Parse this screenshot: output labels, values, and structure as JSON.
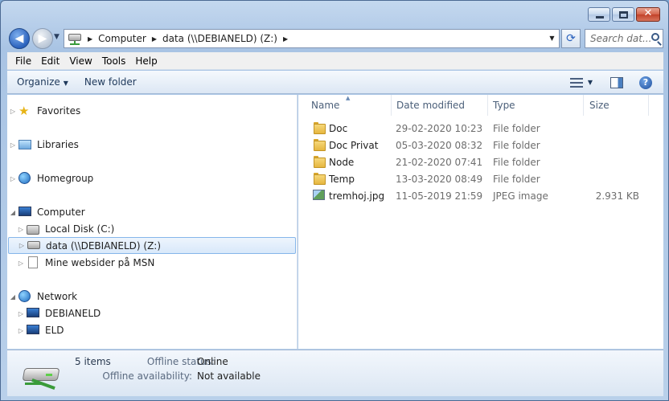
{
  "window": {
    "caption": {
      "close_glyph": "✕"
    }
  },
  "nav": {
    "back_glyph": "◀",
    "forward_glyph": "▶",
    "address": {
      "segments": [
        "Computer",
        "data (\\\\DEBIANELD) (Z:)"
      ],
      "separator_glyph": "▶",
      "dropdown_glyph": "▼"
    },
    "refresh_glyph": "⟳",
    "search_placeholder": "Search dat..."
  },
  "menu": [
    "File",
    "Edit",
    "View",
    "Tools",
    "Help"
  ],
  "commands": {
    "organize": "Organize",
    "organize_dd": "▼",
    "new_folder": "New folder",
    "views_dd": "▼",
    "help_glyph": "?"
  },
  "navpane": {
    "items": [
      {
        "label": "Favorites",
        "icon": "star-icon",
        "level": 0,
        "collapsed": true
      },
      {
        "label": "Libraries",
        "icon": "libraries-icon",
        "level": 0,
        "collapsed": true
      },
      {
        "label": "Homegroup",
        "icon": "homegroup-icon",
        "level": 0,
        "collapsed": true
      },
      {
        "label": "Computer",
        "icon": "computer-icon",
        "level": 0,
        "expanded": true
      },
      {
        "label": "Local Disk (C:)",
        "icon": "local-disk-icon",
        "level": 1,
        "collapsed": true
      },
      {
        "label": "data (\\\\DEBIANELD) (Z:)",
        "icon": "network-drive-icon",
        "level": 1,
        "collapsed": true,
        "selected": true
      },
      {
        "label": "Mine websider på MSN",
        "icon": "page-icon",
        "level": 1,
        "collapsed": true
      },
      {
        "label": "Network",
        "icon": "network-icon",
        "level": 0,
        "expanded": true
      },
      {
        "label": "DEBIANELD",
        "icon": "network-computer-icon",
        "level": 1,
        "collapsed": true
      },
      {
        "label": "ELD",
        "icon": "network-computer-icon",
        "level": 1,
        "collapsed": true
      }
    ],
    "collapsed_glyph": "▷",
    "expanded_glyph": "◢"
  },
  "filelist": {
    "columns": [
      "Name",
      "Date modified",
      "Type",
      "Size"
    ],
    "sort_glyph": "▲",
    "rows": [
      {
        "name": "Doc",
        "date": "29-02-2020 10:23",
        "type": "File folder",
        "size": "",
        "icon": "folder-icon"
      },
      {
        "name": "Doc Privat",
        "date": "05-03-2020 08:32",
        "type": "File folder",
        "size": "",
        "icon": "folder-icon"
      },
      {
        "name": "Node",
        "date": "21-02-2020 07:41",
        "type": "File folder",
        "size": "",
        "icon": "folder-icon"
      },
      {
        "name": "Temp",
        "date": "13-03-2020 08:49",
        "type": "File folder",
        "size": "",
        "icon": "folder-icon"
      },
      {
        "name": "tremhoj.jpg",
        "date": "11-05-2019 21:59",
        "type": "JPEG image",
        "size": "2.931 KB",
        "icon": "jpeg-image-icon"
      }
    ]
  },
  "details": {
    "count": "5 items",
    "offline_status_label": "Offline status:",
    "offline_status_value": "Online",
    "offline_avail_label": "Offline availability:",
    "offline_avail_value": "Not available"
  }
}
